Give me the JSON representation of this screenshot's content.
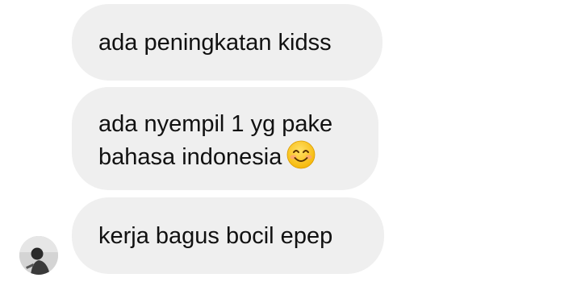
{
  "messages": [
    {
      "lines": [
        "ada peningkatan kidss"
      ]
    },
    {
      "lines": [
        "ada nyempil 1 yg pake",
        "bahasa indonesia"
      ],
      "trailing_emoji": "smiling-face-with-smiling-eyes"
    },
    {
      "lines": [
        "kerja bagus bocil epep"
      ]
    }
  ],
  "sender": {
    "avatar": "profile-photo"
  },
  "colors": {
    "bubble": "#efefef",
    "text": "#111111",
    "emoji_face": "#ffcc33",
    "emoji_cheek": "#ff9f7a"
  }
}
